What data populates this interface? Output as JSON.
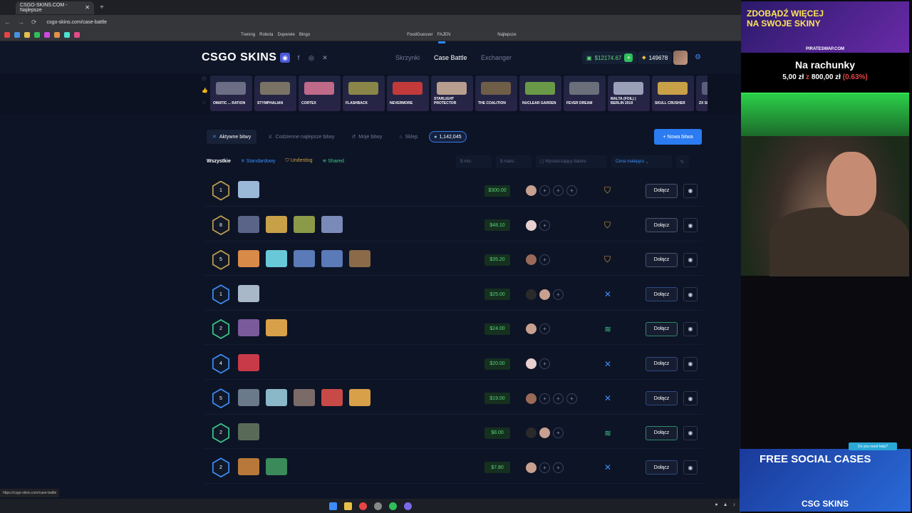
{
  "browser": {
    "tab_title": "CSGO-SKINS.COM - Najlepsze",
    "url": "csgo-skins.com/case-battle",
    "bookmarks": [
      "Trening",
      "Robota",
      "Duperele",
      "Bingo",
      "FoodGuesser",
      "FAJEN",
      "Najlepsze"
    ],
    "status_url": "https://csgo-skins.com/case-battle"
  },
  "header": {
    "logo": "CSGO SKINS",
    "nav": {
      "cases": "Skrzynki",
      "battle": "Case Battle",
      "exchanger": "Exchanger"
    },
    "balance": "$12174.67",
    "coins": "149678"
  },
  "drops": [
    {
      "name": "OMATIC ... RATION",
      "color": "#6b6e85"
    },
    {
      "name": "STYMPHALIAN",
      "color": "#7a7365"
    },
    {
      "name": "CORTEX",
      "color": "#c06a8a"
    },
    {
      "name": "FLASHBACK",
      "color": "#8a8548"
    },
    {
      "name": "NEVERMORE",
      "color": "#c23a3a"
    },
    {
      "name": "STARLIGHT PROTECTOR",
      "color": "#b89e8e"
    },
    {
      "name": "THE COALITION",
      "color": "#6e5e48"
    },
    {
      "name": "NUCLEAR GARDEN",
      "color": "#6a9a48"
    },
    {
      "name": "FEVER DREAM",
      "color": "#6a6f7a"
    },
    {
      "name": "MALTA (FOIL) | BERLIN 2019",
      "color": "#9aa0b8"
    },
    {
      "name": "SKULL CRUSHER",
      "color": "#c8a048"
    },
    {
      "name": "ZX SP",
      "color": "#5a5f7a"
    }
  ],
  "tabs": {
    "active": "Aktywne bitwy",
    "daily": "Codzienne najlepsze bitwy",
    "mine": "Moje bitwy",
    "shop": "Sklep",
    "count": "1,142,045",
    "new_battle": "+ Nowa bitwa"
  },
  "filters": {
    "all": "Wszystkie",
    "standard": "Standardowy",
    "underdog": "Underdog",
    "shared": "Shared",
    "min_placeholder": "$ min.",
    "max_placeholder": "$ maks.",
    "balance": "Wystarczający balans",
    "sort": "Cena malejąco"
  },
  "battles": [
    {
      "rounds": "1",
      "price": "$300.00",
      "cases": [
        "#9ab8d8"
      ],
      "players": 4,
      "joined": 1,
      "mode": "underdog",
      "ring": "#c0a050"
    },
    {
      "rounds": "8",
      "price": "$48.10",
      "cases": [
        "#5a6488",
        "#c8a048",
        "#8a9a48",
        "#7a8ab8"
      ],
      "players": 2,
      "joined": 1,
      "mode": "underdog",
      "ring": "#c0a050"
    },
    {
      "rounds": "5",
      "price": "$35.20",
      "cases": [
        "#d88a48",
        "#68c8d8",
        "#5a7ab8",
        "#5a7ab8",
        "#8a6a48"
      ],
      "players": 2,
      "joined": 1,
      "mode": "underdog",
      "ring": "#c0a050"
    },
    {
      "rounds": "1",
      "price": "$25.00",
      "cases": [
        "#a8b8c8"
      ],
      "players": 3,
      "joined": 2,
      "mode": "standard",
      "ring": "#3d8df5"
    },
    {
      "rounds": "2",
      "price": "$24.00",
      "cases": [
        "#7a5a9a",
        "#d8a048"
      ],
      "players": 2,
      "joined": 1,
      "mode": "shared",
      "ring": "#3ac98a"
    },
    {
      "rounds": "4",
      "price": "$20.00",
      "cases": [
        "#c83a48"
      ],
      "players": 2,
      "joined": 1,
      "mode": "standard",
      "ring": "#3d8df5"
    },
    {
      "rounds": "5",
      "price": "$19.00",
      "cases": [
        "#6a7a8a",
        "#8ab8c8",
        "#7a6a68",
        "#c84a48",
        "#d8a048"
      ],
      "players": 4,
      "joined": 1,
      "mode": "standard",
      "ring": "#3d8df5"
    },
    {
      "rounds": "2",
      "price": "$8.00",
      "cases": [
        "#5a6a58"
      ],
      "players": 3,
      "joined": 2,
      "mode": "shared",
      "ring": "#3ac98a"
    },
    {
      "rounds": "2",
      "price": "$7.80",
      "cases": [
        "#b8783a",
        "#3a8a5a"
      ],
      "players": 3,
      "joined": 1,
      "mode": "standard",
      "ring": "#3d8df5"
    }
  ],
  "join_label": "Dołącz",
  "overlay": {
    "ad_line1": "ZDOBĄDŹ WIĘCEJ",
    "ad_line2": "NA SWOJE SKINY",
    "ad_site": "PIRATESWAP.COM",
    "goal_title": "Na rachunky",
    "goal_current": "5,00 zł",
    "goal_sep": "z",
    "goal_target": "800,00 zł",
    "goal_pct": "(0.63%)",
    "help": "Do you need help?",
    "ad_bottom": "FREE SOCIAL CASES",
    "ad_bottom_brand": "CSG SKINS"
  },
  "colors": {
    "accent": "#2b7cf2",
    "price": "#54d57b",
    "underdog": "#d1a03e",
    "shared": "#3ac98a"
  }
}
